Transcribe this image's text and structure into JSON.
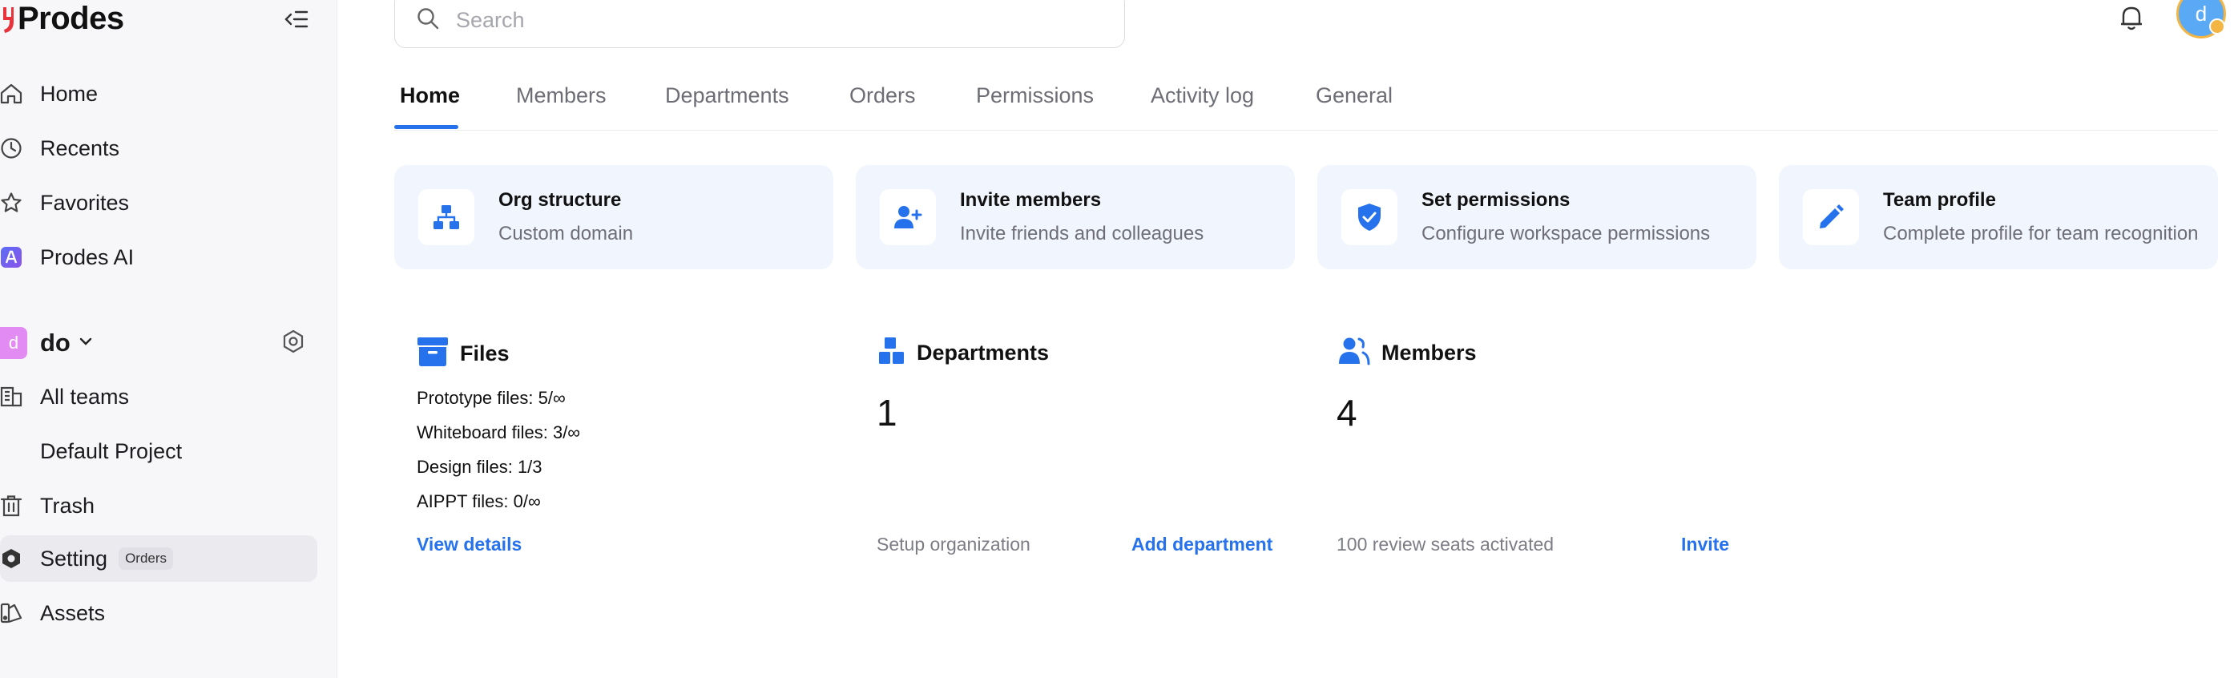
{
  "app": {
    "name": "Prodes"
  },
  "search": {
    "placeholder": "Search"
  },
  "sidebar": {
    "items": [
      {
        "label": "Home"
      },
      {
        "label": "Recents"
      },
      {
        "label": "Favorites"
      },
      {
        "label": "Prodes AI"
      }
    ],
    "team": {
      "initial": "d",
      "name": "do"
    },
    "team_items": [
      {
        "label": "All teams"
      },
      {
        "label": "Default Project"
      },
      {
        "label": "Trash"
      },
      {
        "label": "Setting",
        "badge": "Orders"
      },
      {
        "label": "Assets"
      }
    ]
  },
  "user": {
    "initial": "d"
  },
  "tabs": [
    {
      "label": "Home"
    },
    {
      "label": "Members"
    },
    {
      "label": "Departments"
    },
    {
      "label": "Orders"
    },
    {
      "label": "Permissions"
    },
    {
      "label": "Activity log"
    },
    {
      "label": "General"
    }
  ],
  "cards": [
    {
      "title": "Org structure",
      "subtitle": "Custom domain"
    },
    {
      "title": "Invite members",
      "subtitle": "Invite friends and colleagues"
    },
    {
      "title": "Set permissions",
      "subtitle": "Configure workspace permissions"
    },
    {
      "title": "Team profile",
      "subtitle": "Complete profile for team recognition"
    }
  ],
  "files": {
    "title": "Files",
    "lines": [
      "Prototype files: 5/∞",
      "Whiteboard files: 3/∞",
      "Design files: 1/3",
      "AIPPT files: 0/∞"
    ],
    "link": "View details"
  },
  "departments": {
    "title": "Departments",
    "count": "1",
    "note": "Setup organization",
    "link": "Add department"
  },
  "members": {
    "title": "Members",
    "count": "4",
    "note": "100 review seats activated",
    "link": "Invite"
  },
  "colors": {
    "accent": "#2672ec",
    "card_bg": "#f1f5fd",
    "sidebar_bg": "#f7f7f9"
  }
}
